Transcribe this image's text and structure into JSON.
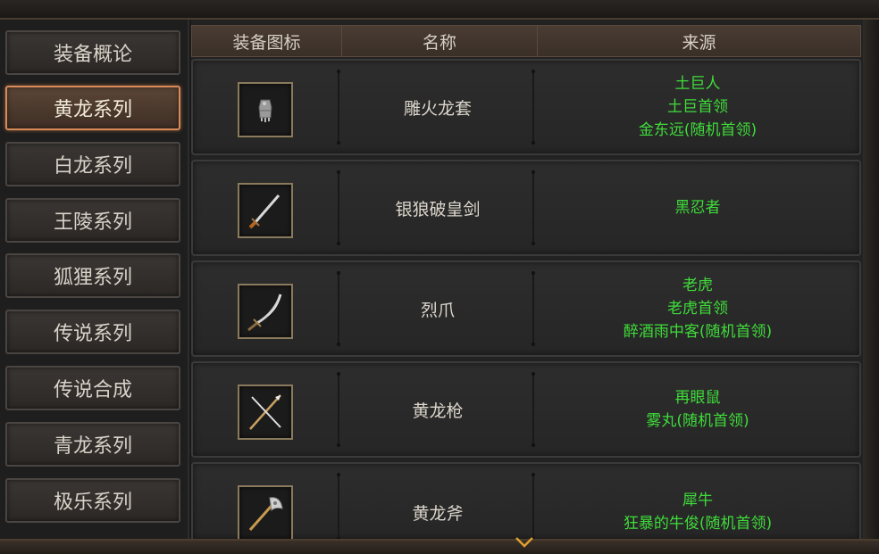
{
  "sidebar": {
    "items": [
      {
        "label": "装备概论",
        "active": false
      },
      {
        "label": "黄龙系列",
        "active": true
      },
      {
        "label": "白龙系列",
        "active": false
      },
      {
        "label": "王陵系列",
        "active": false
      },
      {
        "label": "狐狸系列",
        "active": false
      },
      {
        "label": "传说系列",
        "active": false
      },
      {
        "label": "传说合成",
        "active": false
      },
      {
        "label": "青龙系列",
        "active": false
      },
      {
        "label": "极乐系列",
        "active": false
      }
    ]
  },
  "table": {
    "headers": {
      "icon": "装备图标",
      "name": "名称",
      "source": "来源"
    },
    "rows": [
      {
        "icon": "gauntlet-icon",
        "name": "雕火龙套",
        "sources": [
          "土巨人",
          "土巨首领",
          "金东远(随机首领)"
        ]
      },
      {
        "icon": "sword-icon",
        "name": "银狼破皇剑",
        "sources": [
          "黑忍者"
        ]
      },
      {
        "icon": "scimitar-icon",
        "name": "烈爪",
        "sources": [
          "老虎",
          "老虎首领",
          "醉酒雨中客(随机首领)"
        ]
      },
      {
        "icon": "spear-icon",
        "name": "黄龙枪",
        "sources": [
          "再眼鼠",
          "雾丸(随机首领)"
        ]
      },
      {
        "icon": "axe-icon",
        "name": "黄龙斧",
        "sources": [
          "犀牛",
          "狂暴的牛俊(随机首领)"
        ]
      }
    ]
  },
  "colors": {
    "accent": "#d88a5a",
    "source_text": "#3fdc3a",
    "icon_frame": "#8a7a5c"
  }
}
